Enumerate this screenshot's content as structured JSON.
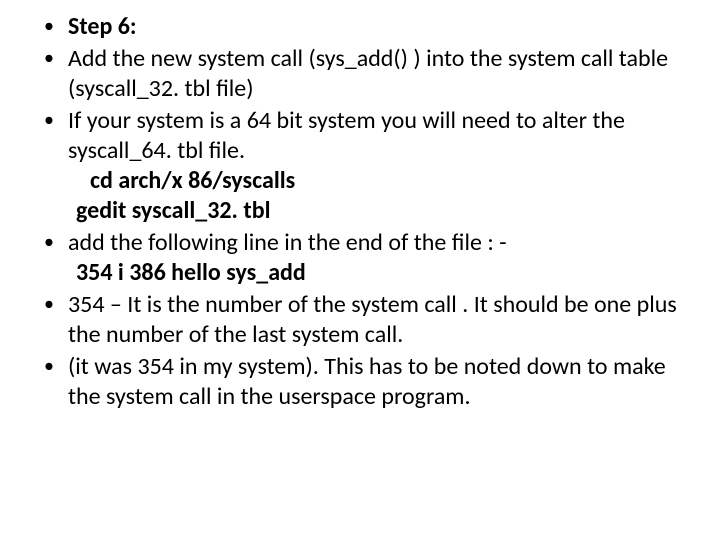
{
  "slide": {
    "bullets": [
      {
        "type": "bold",
        "text": "Step 6:"
      },
      {
        "type": "text",
        "text": "Add the new system call (sys_add() ) into the system call table (syscall_32. tbl file)"
      },
      {
        "type": "text",
        "text": "If your system is a 64 bit system you will need to alter the syscall_64. tbl file."
      },
      {
        "type": "code",
        "lines": [
          " cd arch/x 86/syscalls",
          "gedit syscall_32. tbl"
        ]
      },
      {
        "type": "text",
        "text": "add the following line in the end of the file : -"
      },
      {
        "type": "code2",
        "lines": [
          "  354  i 386  hello  sys_add"
        ]
      },
      {
        "type": "text",
        "text": "354 – It is the number of the system call . It should be one plus the number of the last system call."
      },
      {
        "type": "text",
        "text": "(it was 354 in my system). This has to be noted down to make the system call in the userspace program."
      }
    ]
  }
}
